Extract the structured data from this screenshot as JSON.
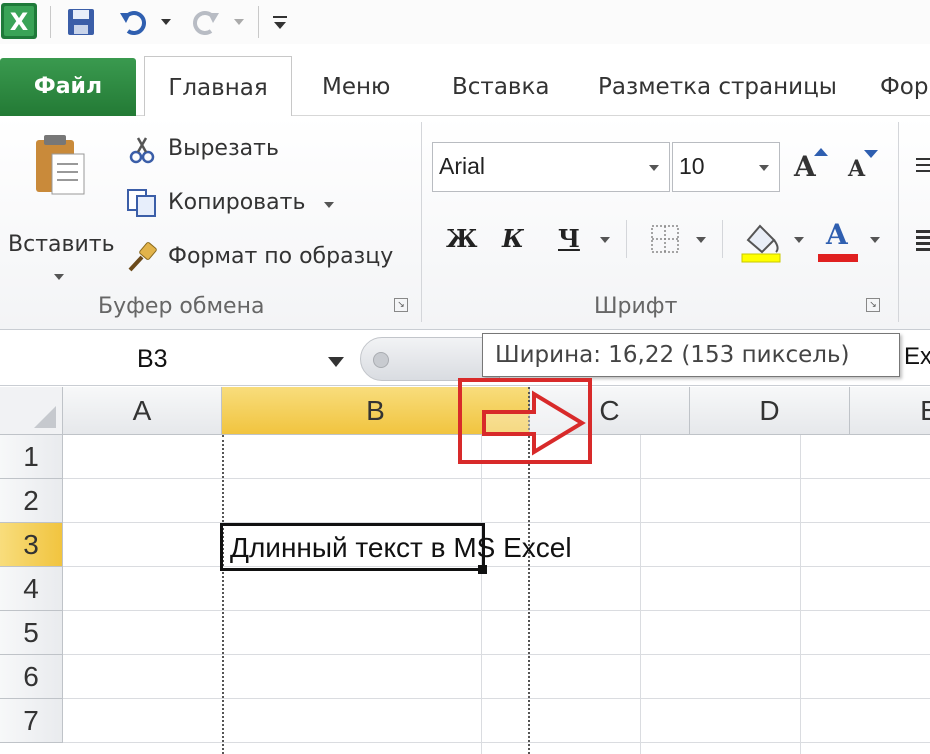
{
  "quick_access": {
    "app_icon": "excel-logo-icon",
    "save_icon": "floppy-save-icon",
    "undo_icon": "undo-arrow-icon",
    "redo_icon": "redo-arrow-icon",
    "customize_icon": "customize-toolbar-icon"
  },
  "tabs": {
    "file": "Файл",
    "home": "Главная",
    "menu": "Меню",
    "insert": "Вставка",
    "page_layout": "Разметка страницы",
    "formulas_partial": "Фор"
  },
  "clipboard": {
    "paste_label": "Вставить",
    "cut_label": "Вырезать",
    "copy_label": "Копировать",
    "format_painter_label": "Формат по образцу",
    "group_label": "Буфер обмена"
  },
  "font": {
    "font_name": "Arial",
    "font_size": "10",
    "bold_label": "Ж",
    "italic_label": "К",
    "underline_label": "Ч",
    "grow_label": "A",
    "shrink_label": "A",
    "font_color_label": "A",
    "group_label": "Шрифт",
    "fill_color": "#ffff00",
    "font_color": "#e02020"
  },
  "formula_bar": {
    "name_box": "B3",
    "content_partial": "Ex"
  },
  "tooltip": {
    "text": "Ширина: 16,22 (153 пиксель)"
  },
  "grid": {
    "columns": [
      "A",
      "B",
      "C",
      "D",
      "E"
    ],
    "rows": [
      "1",
      "2",
      "3",
      "4",
      "5",
      "6",
      "7"
    ],
    "active_column": "B",
    "active_row": "3",
    "cell_b3": "Длинный текст в MS Excel"
  },
  "colors": {
    "file_tab": "#2e8b40",
    "active_header": "#f5cf55",
    "annotation_red": "#d82a2a"
  }
}
